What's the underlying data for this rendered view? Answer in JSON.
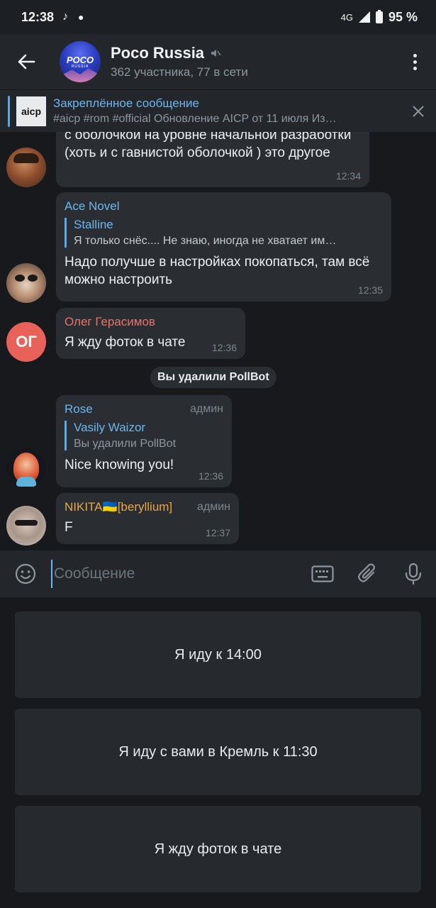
{
  "status_bar": {
    "time": "12:38",
    "network": "4G",
    "battery": "95 %"
  },
  "header": {
    "avatar_text_1": "POCO",
    "avatar_text_2": "RUSSIA",
    "title": "Poco Russia",
    "subtitle": "362 участника, 77 в сети"
  },
  "pinned": {
    "title": "Закреплённое сообщение",
    "text": "#aicp #rom #official  Обновление AICP от 11 июля  Из…",
    "thumb_text": "aicp"
  },
  "messages": [
    {
      "text": "с оболочкой на уровне начальной разработки  (хоть и с гавнистой оболочкой ) это другое",
      "time": "12:34"
    },
    {
      "sender": "Ace Novel",
      "reply_name": "Stalline",
      "reply_text": "Я только снёс.... Не знаю, иногда не хватает им…",
      "text": "Надо получше в настройках покопаться, там всё можно настроить",
      "time": "12:35"
    },
    {
      "sender": "Олег Герасимов",
      "initials": "ОГ",
      "text": "Я жду фоток в чате",
      "time": "12:36"
    },
    {
      "sender": "Rose",
      "badge": "админ",
      "reply_name": "Vasily Waizor",
      "reply_text": "Вы удалили PollBot",
      "text": "Nice knowing you!",
      "time": "12:36"
    },
    {
      "sender": "NIKITA🇺🇦[beryllium]",
      "badge": "админ",
      "text": "F",
      "time": "12:37"
    }
  ],
  "service_message": "Вы удалили PollBot",
  "input": {
    "placeholder": "Сообщение"
  },
  "keyboard_buttons": [
    "Я иду к 14:00",
    "Я иду с вами в Кремль к 11:30",
    "Я жду фоток в чате"
  ],
  "colors": {
    "accent": "#6cb6f0",
    "bubble": "#2a2e33",
    "header": "#23272b",
    "oleg_name": "#e8736b",
    "nikita_name": "#e8a64a",
    "rose_name": "#6cb6f0"
  }
}
